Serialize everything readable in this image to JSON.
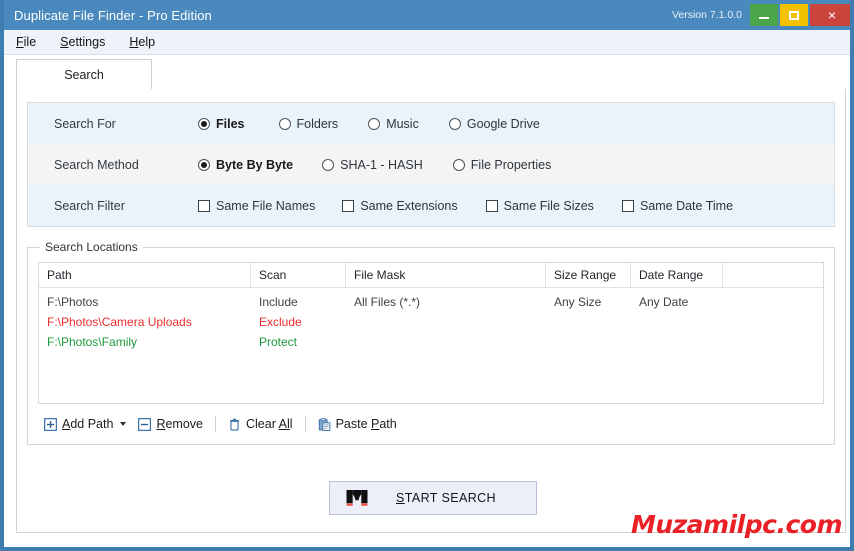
{
  "window": {
    "title": "Duplicate File Finder - Pro Edition",
    "version": "Version 7.1.0.0",
    "controls": {
      "minimize": "minimize",
      "maximize": "maximize",
      "close": "×"
    }
  },
  "menubar": {
    "items": [
      {
        "label": "File",
        "accel": "F"
      },
      {
        "label": "Settings",
        "accel": "S"
      },
      {
        "label": "Help",
        "accel": "H"
      }
    ]
  },
  "tabs": [
    {
      "label": "Search",
      "active": true
    }
  ],
  "options": {
    "search_for": {
      "label": "Search For",
      "choices": [
        {
          "label": "Files",
          "selected": true
        },
        {
          "label": "Folders",
          "selected": false
        },
        {
          "label": "Music",
          "selected": false
        },
        {
          "label": "Google Drive",
          "selected": false
        }
      ]
    },
    "search_method": {
      "label": "Search Method",
      "choices": [
        {
          "label": "Byte By Byte",
          "selected": true
        },
        {
          "label": "SHA-1 - HASH",
          "selected": false
        },
        {
          "label": "File Properties",
          "selected": false
        }
      ]
    },
    "search_filter": {
      "label": "Search Filter",
      "choices": [
        {
          "label": "Same File Names",
          "checked": false
        },
        {
          "label": "Same Extensions",
          "checked": false
        },
        {
          "label": "Same File Sizes",
          "checked": false
        },
        {
          "label": "Same Date Time",
          "checked": false
        }
      ]
    }
  },
  "search_locations": {
    "group_title": "Search Locations",
    "columns": [
      "Path",
      "Scan",
      "File Mask",
      "Size Range",
      "Date Range"
    ],
    "rows": [
      {
        "path": "F:\\Photos",
        "scan": "Include",
        "mask": "All Files (*.*)",
        "size": "Any Size",
        "date": "Any Date",
        "color": "#3c4146"
      },
      {
        "path": "F:\\Photos\\Camera Uploads",
        "scan": "Exclude",
        "mask": "",
        "size": "",
        "date": "",
        "color": "#ef2b2b"
      },
      {
        "path": "F:\\Photos\\Family",
        "scan": "Protect",
        "mask": "",
        "size": "",
        "date": "",
        "color": "#1d9b3c"
      }
    ],
    "toolbar": [
      {
        "name": "add-path",
        "label": "Add Path",
        "accel": "A",
        "icon": "plus-box-icon",
        "has_dropdown": true
      },
      {
        "name": "remove",
        "label": "Remove",
        "accel": "R",
        "icon": "minus-box-icon",
        "has_dropdown": false
      },
      {
        "name": "clear-all",
        "label": "Clear All",
        "accel": "Al",
        "icon": "trash-icon",
        "has_dropdown": false
      },
      {
        "name": "paste-path",
        "label": "Paste Path",
        "accel": "P",
        "icon": "clipboard-icon",
        "has_dropdown": false
      }
    ]
  },
  "start_search": {
    "label": "START SEARCH",
    "accel": "S",
    "icon": "binoculars-icon"
  },
  "watermark": {
    "text": "Muzamilpc.com"
  },
  "colors": {
    "titlebar": "#4a89bd",
    "minimize": "#4aa648",
    "maximize": "#f2c200",
    "close": "#c9453c",
    "row_blue": "#eaf3fa",
    "row_grey": "#f4f4f4",
    "accent_red": "#ef2b2b",
    "accent_green": "#1d9b3c",
    "watermark_red": "#ea2027"
  }
}
